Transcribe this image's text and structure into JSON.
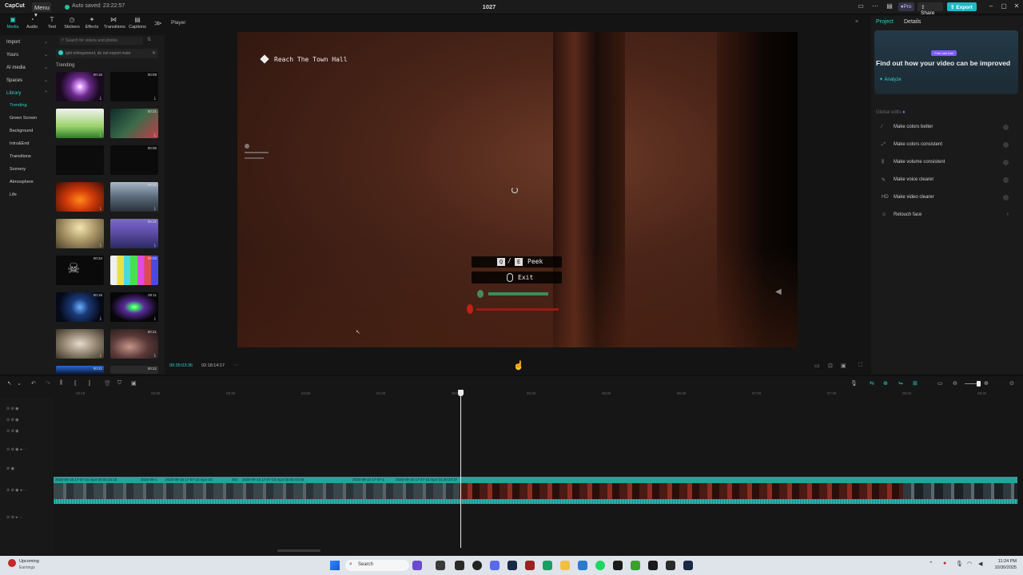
{
  "titlebar": {
    "logo": "CapCut",
    "menu_label": "Menu",
    "autosave": "Auto saved: 23:22:57",
    "doc_title": "1027",
    "pro_label": "Pro",
    "share_label": "Share",
    "export_label": "Export",
    "accent": "#1fb8c9"
  },
  "tool_tabs": [
    {
      "label": "Media",
      "icon": "media-icon"
    },
    {
      "label": "Audio",
      "icon": "audio-icon"
    },
    {
      "label": "Text",
      "icon": "text-icon"
    },
    {
      "label": "Stickers",
      "icon": "stickers-icon"
    },
    {
      "label": "Effects",
      "icon": "effects-icon"
    },
    {
      "label": "Transitions",
      "icon": "transitions-icon"
    },
    {
      "label": "Captions",
      "icon": "captions-icon"
    }
  ],
  "leftnav": {
    "items": [
      "Import",
      "Yours",
      "AI media",
      "Spaces",
      "Library"
    ],
    "library_sub": [
      "Trending",
      "Green Screen",
      "Background",
      "Intro&End",
      "Transitions",
      "Scenery",
      "Atmosphere",
      "Life"
    ]
  },
  "media": {
    "search_placeholder": "Search for videos and photos",
    "warning": "ight infringement, do not export mate",
    "section": "Trending",
    "durations": [
      "00:15",
      "00:09",
      "",
      "00:21",
      "",
      "00:06",
      "",
      "00:21",
      "",
      "00:21",
      "00:34",
      "00:03",
      "00:16",
      "00:11",
      "",
      "00:21",
      "00:21",
      "00:22"
    ]
  },
  "player": {
    "label": "Player",
    "objective": "Reach The Town Hall",
    "peek_keys": [
      "Q",
      "E"
    ],
    "peek_label": "Peek",
    "exit_label": "Exit",
    "timecode": "00:35:03:36",
    "duration": "02:18:14:17"
  },
  "right_panel": {
    "tab_project": "Project",
    "tab_details": "Details",
    "free_badge": "Free use trial",
    "promo_title": "Find out how your video can be improved",
    "analyze_label": "Analyze",
    "global_edits": "Global edits",
    "tools": [
      {
        "label": "Make colors better",
        "icon": "color-wand-icon"
      },
      {
        "label": "Make colors consistent",
        "icon": "color-match-icon"
      },
      {
        "label": "Make volume consistent",
        "icon": "volume-sliders-icon"
      },
      {
        "label": "Make voice clearer",
        "icon": "voice-icon"
      },
      {
        "label": "Make video clearer",
        "icon": "hd-icon"
      },
      {
        "label": "Retouch face",
        "icon": "face-icon"
      }
    ]
  },
  "timeline": {
    "ruler_ticks": [
      "02:10",
      "03:00",
      "03:30",
      "04:00",
      "04:30",
      "05:00",
      "05:30",
      "06:00",
      "06:30",
      "07:00",
      "07:30",
      "08:00",
      "08:30"
    ],
    "clip_labels": [
      "2025-09-15 17-07-10.mp4  00:00:34:15",
      "2025-09-1",
      "2025-09-15 17-07-10.mp4  00:",
      "202",
      "2025-09-15 17-07-10.mp4  00:00:44:05",
      "2025-09-15 17-07-1",
      "2025-09-15 17-07-10.mp4  01:40:37:37"
    ]
  },
  "taskbar": {
    "weather_title": "Upcoming",
    "weather_sub": "Earnings",
    "search_label": "Search",
    "time": "11:24 PM",
    "date": "10/30/2025"
  }
}
